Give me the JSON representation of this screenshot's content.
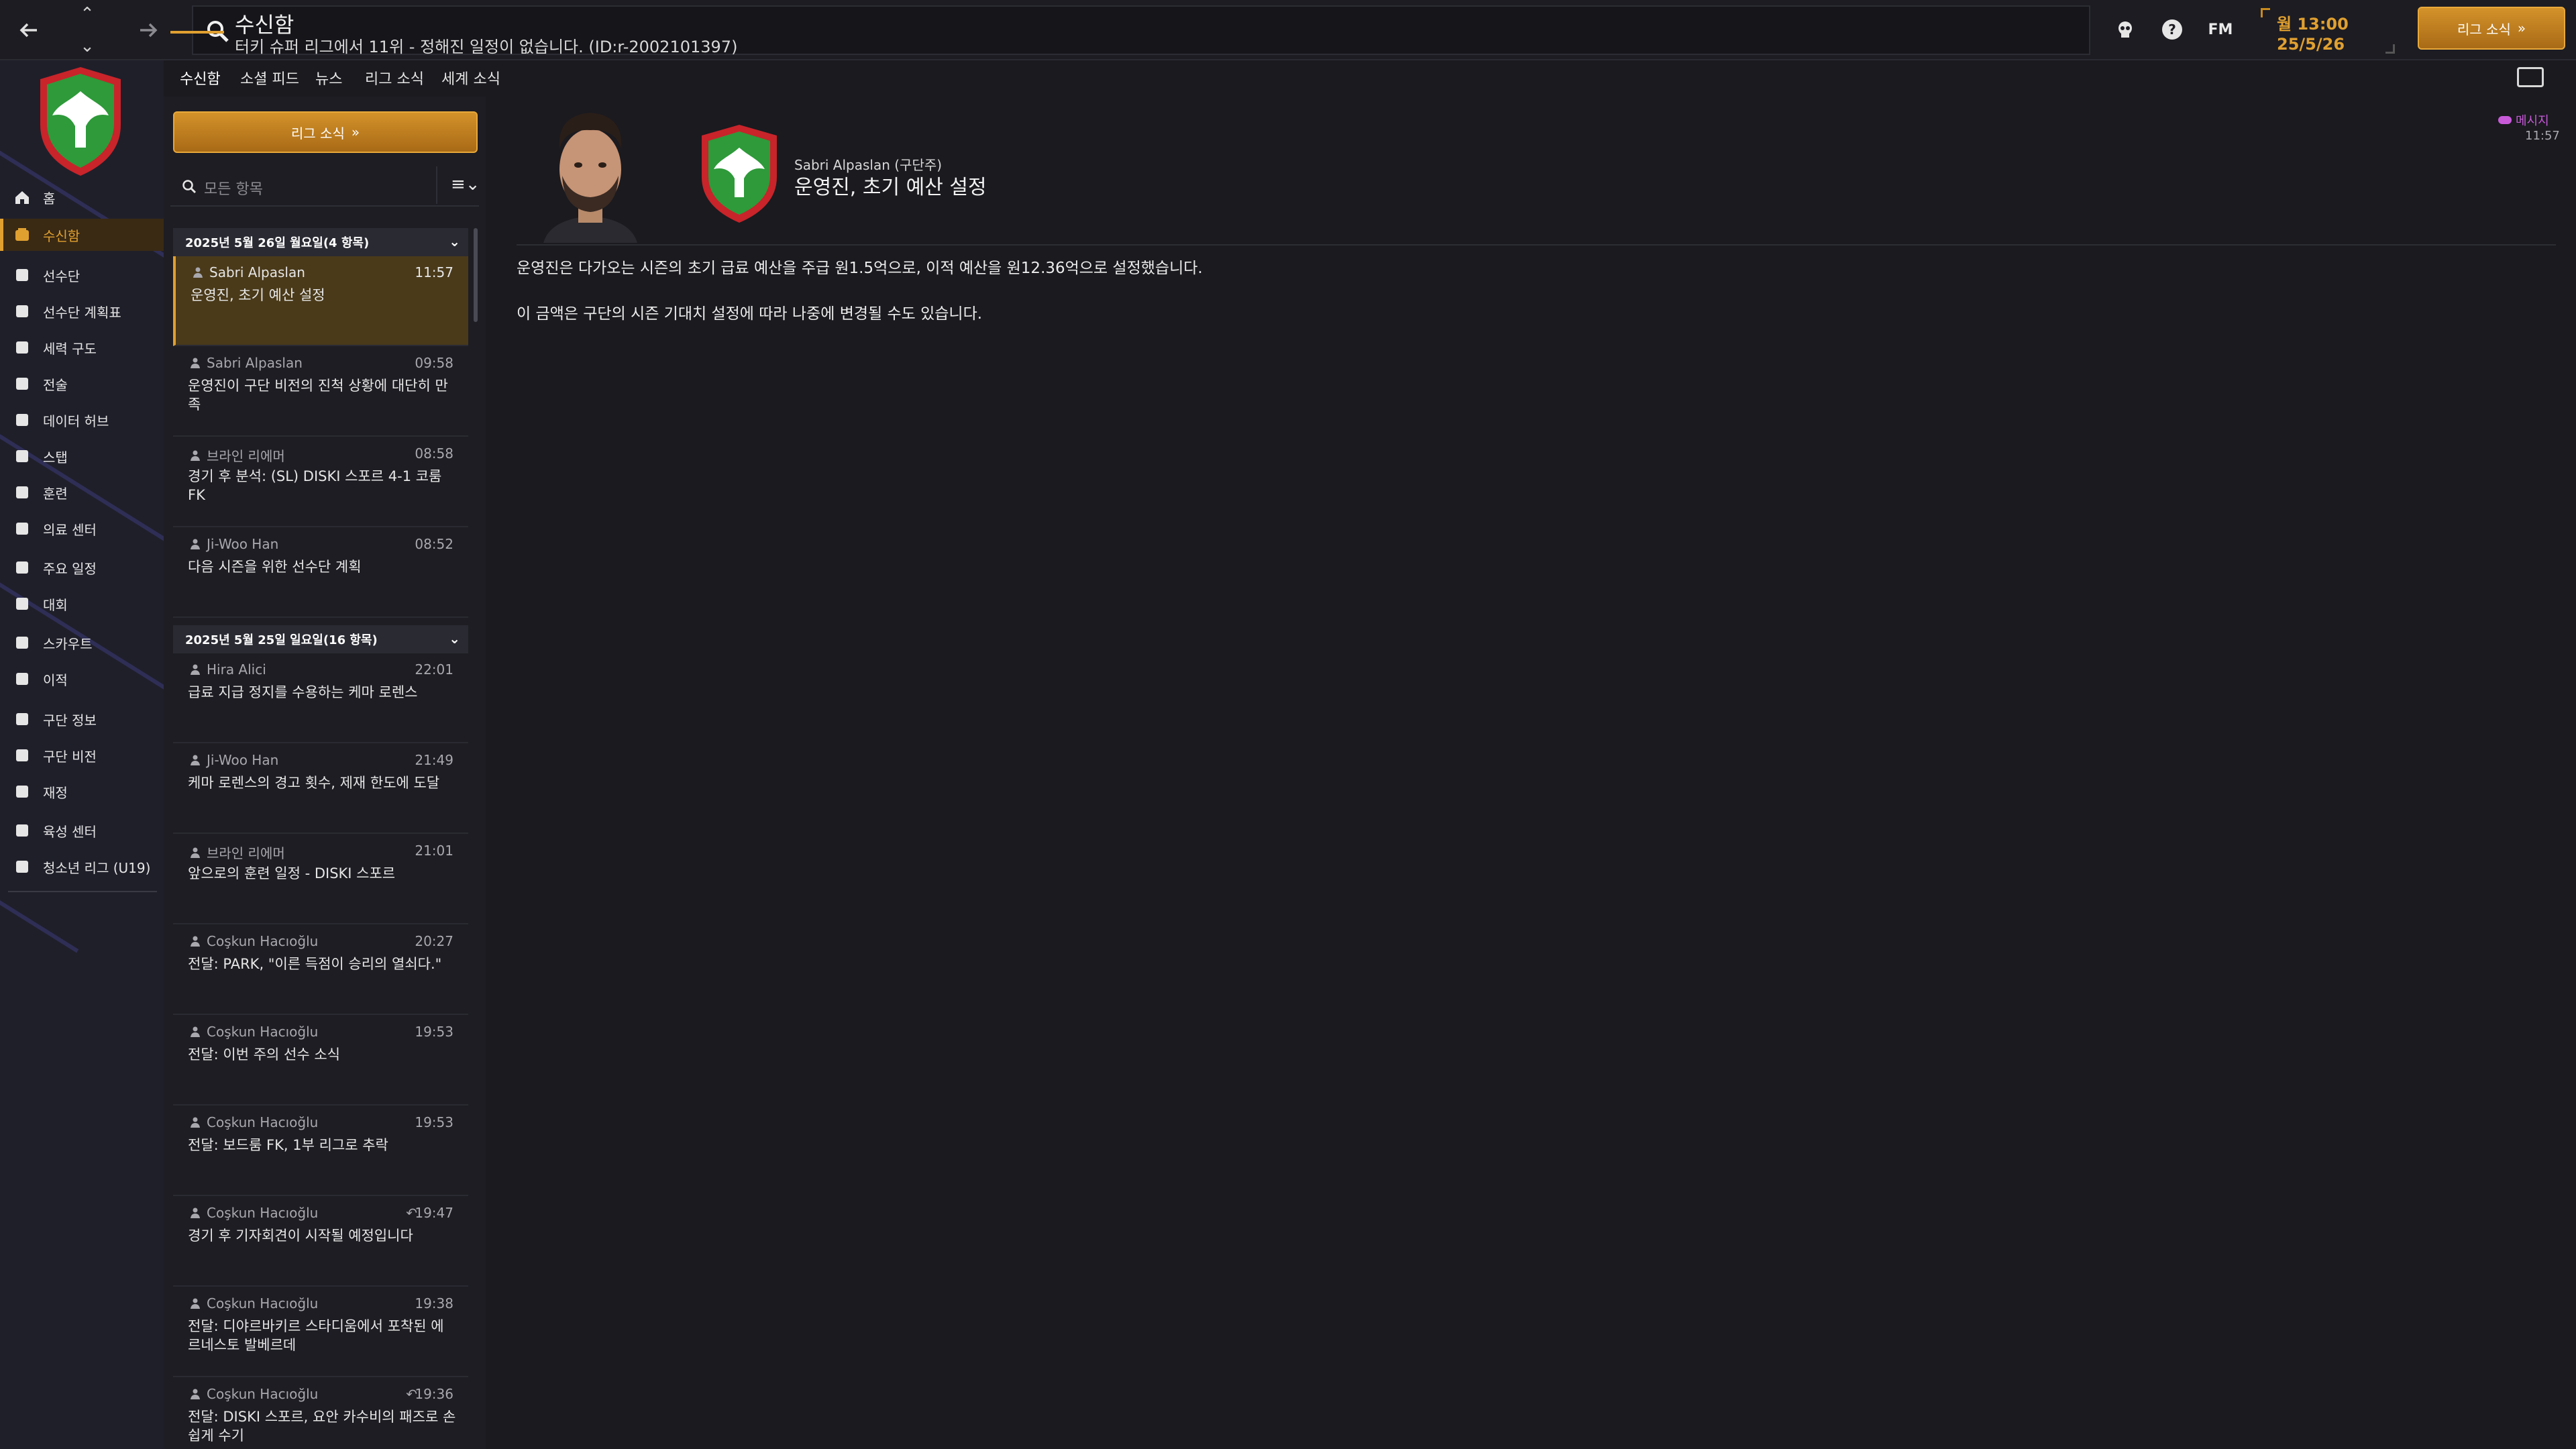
{
  "topbar": {
    "title": "수신함",
    "subtitle": "터키 슈퍼 리그에서 11위 - 정해진 일정이 없습니다. (ID:r-2002101397)",
    "fm_label": "FM",
    "date_line1": "월 13:00",
    "date_line2": "25/5/26",
    "league_news_label": "리그 소식"
  },
  "sidebar": {
    "items": [
      {
        "label": "홈",
        "icon": "home-icon"
      },
      {
        "label": "수신함",
        "icon": "inbox-icon"
      },
      {
        "label": "선수단",
        "icon": "squad-icon"
      },
      {
        "label": "선수단 계획표",
        "icon": "clipboard-icon"
      },
      {
        "label": "세력 구도",
        "icon": "dynamics-icon"
      },
      {
        "label": "전술",
        "icon": "tactics-icon"
      },
      {
        "label": "데이터 허브",
        "icon": "data-icon"
      },
      {
        "label": "스탭",
        "icon": "staff-icon"
      },
      {
        "label": "훈련",
        "icon": "training-icon"
      },
      {
        "label": "의료 센터",
        "icon": "medical-icon"
      },
      {
        "label": "주요 일정",
        "icon": "calendar-icon"
      },
      {
        "label": "대회",
        "icon": "trophy-icon"
      },
      {
        "label": "스카우트",
        "icon": "scout-icon"
      },
      {
        "label": "이적",
        "icon": "transfer-icon"
      },
      {
        "label": "구단 정보",
        "icon": "club-info-icon"
      },
      {
        "label": "구단 비전",
        "icon": "vision-icon"
      },
      {
        "label": "재정",
        "icon": "finance-icon"
      },
      {
        "label": "육성 센터",
        "icon": "development-icon"
      },
      {
        "label": "청소년 리그 (U19)",
        "icon": "youth-icon"
      }
    ],
    "active_index": 1
  },
  "tabs": [
    "수신함",
    "소셜 피드",
    "뉴스",
    "리그 소식",
    "세계 소식"
  ],
  "list": {
    "league_news_button": "리그 소식",
    "search_placeholder": "모든 항목",
    "groups": [
      {
        "header": "2025년 5월 26일 월요일(4 항목)",
        "messages": [
          {
            "sender": "Sabri Alpaslan",
            "time": "11:57",
            "text": "운영진, 초기 예산 설정",
            "selected": true
          },
          {
            "sender": "Sabri Alpaslan",
            "time": "09:58",
            "text": "운영진이 구단 비전의 진척 상황에 대단히 만족"
          },
          {
            "sender": "브라인 리에머",
            "time": "08:58",
            "text": "경기 후 분석: (SL) DISKI 스포르 4-1 코룸 FK"
          },
          {
            "sender": "Ji-Woo Han",
            "time": "08:52",
            "text": "다음 시즌을 위한 선수단 계획"
          }
        ]
      },
      {
        "header": "2025년 5월 25일 일요일(16 항목)",
        "messages": [
          {
            "sender": "Hira Alici",
            "time": "22:01",
            "text": "급료 지급 정지를 수용하는 케마 로렌스"
          },
          {
            "sender": "Ji-Woo Han",
            "time": "21:49",
            "text": "케마 로렌스의 경고 횟수, 제재 한도에 도달"
          },
          {
            "sender": "브라인 리에머",
            "time": "21:01",
            "text": "앞으로의 훈련 일정 - DISKI 스포르"
          },
          {
            "sender": "Coşkun Hacıoğlu",
            "time": "20:27",
            "text": "전달: PARK, \"이른 득점이 승리의 열쇠다.\""
          },
          {
            "sender": "Coşkun Hacıoğlu",
            "time": "19:53",
            "text": "전달: 이번 주의 선수 소식"
          },
          {
            "sender": "Coşkun Hacıoğlu",
            "time": "19:53",
            "text": "전달: 보드룸 FK, 1부 리그로 추락"
          },
          {
            "sender": "Coşkun Hacıoğlu",
            "time": "19:47",
            "text": "경기 후 기자회견이 시작될 예정입니다",
            "reply": "↶"
          },
          {
            "sender": "Coşkun Hacıoğlu",
            "time": "19:38",
            "text": "전달: 디야르바키르 스타디움에서 포착된 에르네스토 발베르데"
          },
          {
            "sender": "Coşkun Hacıoğlu",
            "time": "19:36",
            "text": "전달: DISKI 스포르, 요안 카수비의 패즈로 손쉽게 수기",
            "reply": "↶"
          }
        ]
      }
    ]
  },
  "message": {
    "from": "Sabri Alpaslan (구단주)",
    "subject": "운영진, 초기 예산 설정",
    "badge": "메시지",
    "time": "11:57",
    "body": [
      "운영진은 다가오는 시즌의 초기 급료 예산을 주급 원1.5억으로, 이적 예산을 원12.36억으로 설정했습니다.",
      "이 금액은 구단의 시즌 기대치 설정에 따라 나중에 변경될 수도 있습니다."
    ]
  },
  "colors": {
    "accent": "#e0a030",
    "selected_bg": "#4a3a1a",
    "badge": "#c85ad8",
    "crest_green": "#2e9a3a",
    "crest_red": "#c8242a"
  }
}
